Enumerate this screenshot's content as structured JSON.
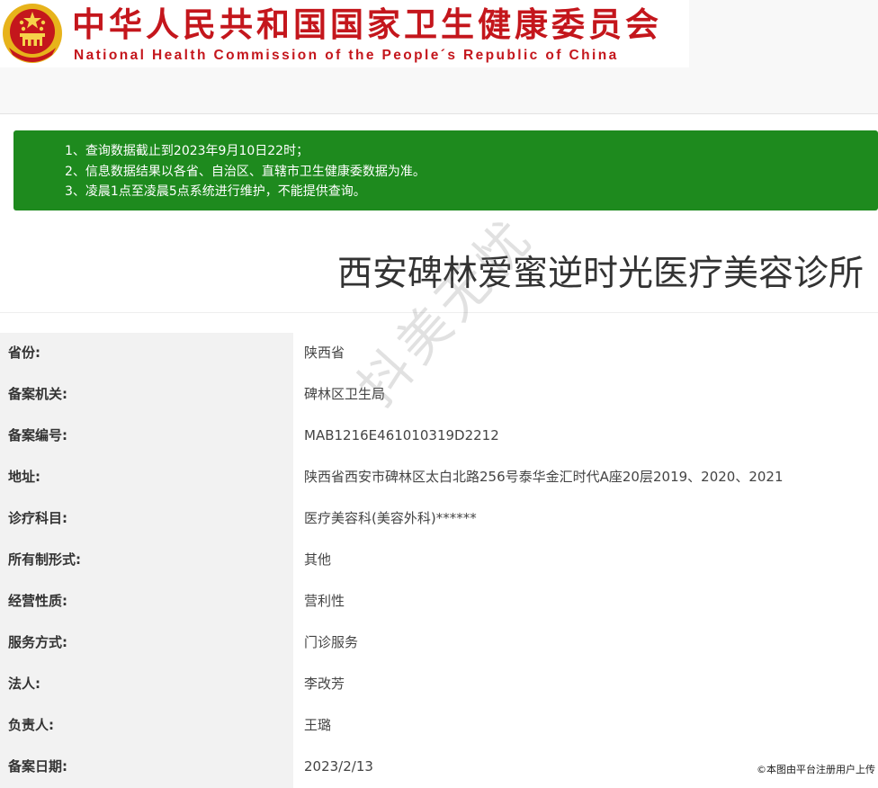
{
  "header": {
    "cn_title": "中华人民共和国国家卫生健康委员会",
    "en_title": "National Health Commission of the People´s Republic of China",
    "emblem_icon": "national-emblem-icon",
    "colors": {
      "brand_red": "#c4161c",
      "emblem_gold": "#e7b31b"
    }
  },
  "notice": {
    "background": "#1e8a1e",
    "lines": [
      "1、查询数据截止到2023年9月10日22时；",
      "2、信息数据结果以各省、自治区、直辖市卫生健康委数据为准。",
      "3、凌晨1点至凌晨5点系统进行维护，不能提供查询。"
    ]
  },
  "record": {
    "title": "西安碑林爱蜜逆时光医疗美容诊所",
    "rows": [
      {
        "label": "省份:",
        "value": "陕西省"
      },
      {
        "label": "备案机关:",
        "value": "碑林区卫生局"
      },
      {
        "label": "备案编号:",
        "value": "MAB1216E461010319D2212"
      },
      {
        "label": "地址:",
        "value": "陕西省西安市碑林区太白北路256号泰华金汇时代A座20层2019、2020、2021"
      },
      {
        "label": "诊疗科目:",
        "value": "医疗美容科(美容外科)******"
      },
      {
        "label": "所有制形式:",
        "value": "其他"
      },
      {
        "label": "经营性质:",
        "value": "营利性"
      },
      {
        "label": "服务方式:",
        "value": "门诊服务"
      },
      {
        "label": "法人:",
        "value": "李改芳"
      },
      {
        "label": "负责人:",
        "value": "王璐"
      },
      {
        "label": "备案日期:",
        "value": "2023/2/13"
      }
    ]
  },
  "watermark": "抖美无忧",
  "credit": "©本图由平台注册用户上传"
}
